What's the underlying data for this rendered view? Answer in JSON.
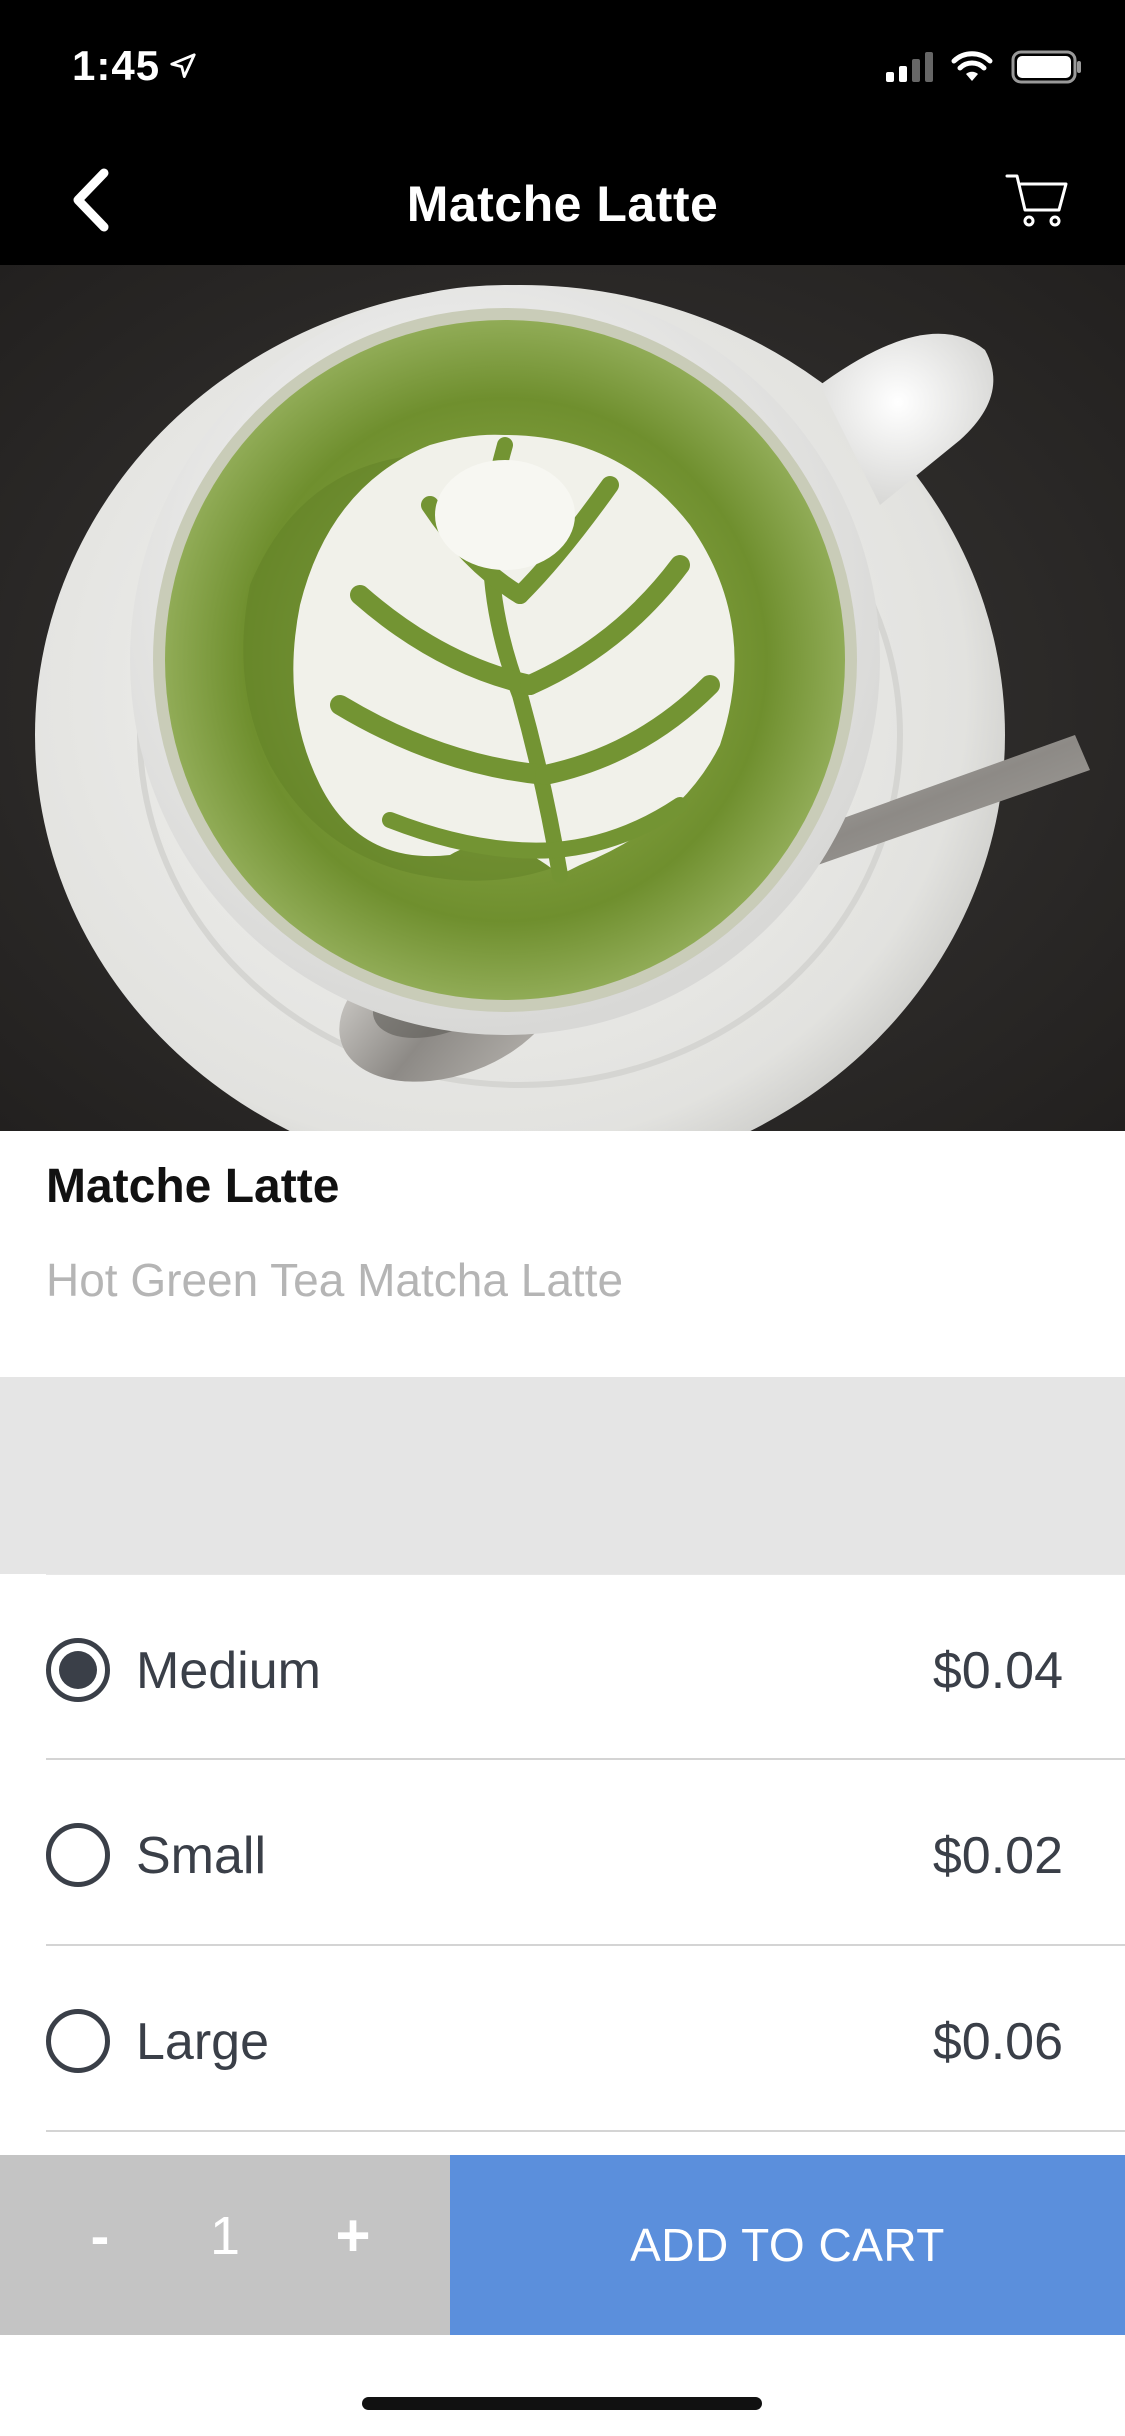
{
  "status_bar": {
    "time": "1:45",
    "icons": [
      "location-arrow-icon",
      "cellular-signal-icon",
      "wifi-icon",
      "battery-icon"
    ]
  },
  "nav": {
    "title": "Matche Latte",
    "back_icon": "chevron-left-icon",
    "cart_icon": "shopping-cart-icon"
  },
  "product": {
    "image": "matcha-latte-photo",
    "name": "Matche Latte",
    "description": "Hot Green Tea Matcha Latte"
  },
  "options": [
    {
      "label": "Medium",
      "price": "$0.04",
      "selected": true
    },
    {
      "label": "Small",
      "price": "$0.02",
      "selected": false
    },
    {
      "label": "Large",
      "price": "$0.06",
      "selected": false
    }
  ],
  "quantity": {
    "minus_label": "-",
    "value": "1",
    "plus_label": "+"
  },
  "add_to_cart_label": "ADD TO CART",
  "colors": {
    "header_bg": "#000000",
    "accent": "#5b8fdc",
    "quantity_bg": "#c4c4c4",
    "radio": "#3a3f48"
  }
}
